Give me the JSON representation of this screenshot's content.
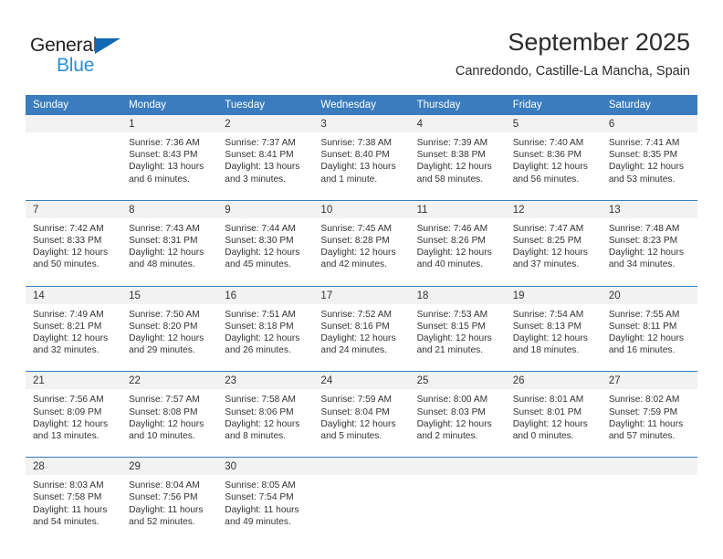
{
  "brand": {
    "name_part1": "General",
    "name_part2": "Blue",
    "color_dark": "#231f20",
    "color_blue": "#2b8fd4",
    "triangle_color": "#1268b3"
  },
  "header": {
    "title": "September 2025",
    "subtitle": "Canredondo, Castille-La Mancha, Spain",
    "accent_color": "#3a7cbe",
    "band_color": "#f2f2f2"
  },
  "calendar": {
    "weekday_headers": [
      "Sunday",
      "Monday",
      "Tuesday",
      "Wednesday",
      "Thursday",
      "Friday",
      "Saturday"
    ],
    "weeks": [
      {
        "days": [
          {
            "num": "",
            "l1": "",
            "l2": "",
            "l3": "",
            "l4": ""
          },
          {
            "num": "1",
            "l1": "Sunrise: 7:36 AM",
            "l2": "Sunset: 8:43 PM",
            "l3": "Daylight: 13 hours",
            "l4": "and 6 minutes."
          },
          {
            "num": "2",
            "l1": "Sunrise: 7:37 AM",
            "l2": "Sunset: 8:41 PM",
            "l3": "Daylight: 13 hours",
            "l4": "and 3 minutes."
          },
          {
            "num": "3",
            "l1": "Sunrise: 7:38 AM",
            "l2": "Sunset: 8:40 PM",
            "l3": "Daylight: 13 hours",
            "l4": "and 1 minute."
          },
          {
            "num": "4",
            "l1": "Sunrise: 7:39 AM",
            "l2": "Sunset: 8:38 PM",
            "l3": "Daylight: 12 hours",
            "l4": "and 58 minutes."
          },
          {
            "num": "5",
            "l1": "Sunrise: 7:40 AM",
            "l2": "Sunset: 8:36 PM",
            "l3": "Daylight: 12 hours",
            "l4": "and 56 minutes."
          },
          {
            "num": "6",
            "l1": "Sunrise: 7:41 AM",
            "l2": "Sunset: 8:35 PM",
            "l3": "Daylight: 12 hours",
            "l4": "and 53 minutes."
          }
        ]
      },
      {
        "days": [
          {
            "num": "7",
            "l1": "Sunrise: 7:42 AM",
            "l2": "Sunset: 8:33 PM",
            "l3": "Daylight: 12 hours",
            "l4": "and 50 minutes."
          },
          {
            "num": "8",
            "l1": "Sunrise: 7:43 AM",
            "l2": "Sunset: 8:31 PM",
            "l3": "Daylight: 12 hours",
            "l4": "and 48 minutes."
          },
          {
            "num": "9",
            "l1": "Sunrise: 7:44 AM",
            "l2": "Sunset: 8:30 PM",
            "l3": "Daylight: 12 hours",
            "l4": "and 45 minutes."
          },
          {
            "num": "10",
            "l1": "Sunrise: 7:45 AM",
            "l2": "Sunset: 8:28 PM",
            "l3": "Daylight: 12 hours",
            "l4": "and 42 minutes."
          },
          {
            "num": "11",
            "l1": "Sunrise: 7:46 AM",
            "l2": "Sunset: 8:26 PM",
            "l3": "Daylight: 12 hours",
            "l4": "and 40 minutes."
          },
          {
            "num": "12",
            "l1": "Sunrise: 7:47 AM",
            "l2": "Sunset: 8:25 PM",
            "l3": "Daylight: 12 hours",
            "l4": "and 37 minutes."
          },
          {
            "num": "13",
            "l1": "Sunrise: 7:48 AM",
            "l2": "Sunset: 8:23 PM",
            "l3": "Daylight: 12 hours",
            "l4": "and 34 minutes."
          }
        ]
      },
      {
        "days": [
          {
            "num": "14",
            "l1": "Sunrise: 7:49 AM",
            "l2": "Sunset: 8:21 PM",
            "l3": "Daylight: 12 hours",
            "l4": "and 32 minutes."
          },
          {
            "num": "15",
            "l1": "Sunrise: 7:50 AM",
            "l2": "Sunset: 8:20 PM",
            "l3": "Daylight: 12 hours",
            "l4": "and 29 minutes."
          },
          {
            "num": "16",
            "l1": "Sunrise: 7:51 AM",
            "l2": "Sunset: 8:18 PM",
            "l3": "Daylight: 12 hours",
            "l4": "and 26 minutes."
          },
          {
            "num": "17",
            "l1": "Sunrise: 7:52 AM",
            "l2": "Sunset: 8:16 PM",
            "l3": "Daylight: 12 hours",
            "l4": "and 24 minutes."
          },
          {
            "num": "18",
            "l1": "Sunrise: 7:53 AM",
            "l2": "Sunset: 8:15 PM",
            "l3": "Daylight: 12 hours",
            "l4": "and 21 minutes."
          },
          {
            "num": "19",
            "l1": "Sunrise: 7:54 AM",
            "l2": "Sunset: 8:13 PM",
            "l3": "Daylight: 12 hours",
            "l4": "and 18 minutes."
          },
          {
            "num": "20",
            "l1": "Sunrise: 7:55 AM",
            "l2": "Sunset: 8:11 PM",
            "l3": "Daylight: 12 hours",
            "l4": "and 16 minutes."
          }
        ]
      },
      {
        "days": [
          {
            "num": "21",
            "l1": "Sunrise: 7:56 AM",
            "l2": "Sunset: 8:09 PM",
            "l3": "Daylight: 12 hours",
            "l4": "and 13 minutes."
          },
          {
            "num": "22",
            "l1": "Sunrise: 7:57 AM",
            "l2": "Sunset: 8:08 PM",
            "l3": "Daylight: 12 hours",
            "l4": "and 10 minutes."
          },
          {
            "num": "23",
            "l1": "Sunrise: 7:58 AM",
            "l2": "Sunset: 8:06 PM",
            "l3": "Daylight: 12 hours",
            "l4": "and 8 minutes."
          },
          {
            "num": "24",
            "l1": "Sunrise: 7:59 AM",
            "l2": "Sunset: 8:04 PM",
            "l3": "Daylight: 12 hours",
            "l4": "and 5 minutes."
          },
          {
            "num": "25",
            "l1": "Sunrise: 8:00 AM",
            "l2": "Sunset: 8:03 PM",
            "l3": "Daylight: 12 hours",
            "l4": "and 2 minutes."
          },
          {
            "num": "26",
            "l1": "Sunrise: 8:01 AM",
            "l2": "Sunset: 8:01 PM",
            "l3": "Daylight: 12 hours",
            "l4": "and 0 minutes."
          },
          {
            "num": "27",
            "l1": "Sunrise: 8:02 AM",
            "l2": "Sunset: 7:59 PM",
            "l3": "Daylight: 11 hours",
            "l4": "and 57 minutes."
          }
        ]
      },
      {
        "days": [
          {
            "num": "28",
            "l1": "Sunrise: 8:03 AM",
            "l2": "Sunset: 7:58 PM",
            "l3": "Daylight: 11 hours",
            "l4": "and 54 minutes."
          },
          {
            "num": "29",
            "l1": "Sunrise: 8:04 AM",
            "l2": "Sunset: 7:56 PM",
            "l3": "Daylight: 11 hours",
            "l4": "and 52 minutes."
          },
          {
            "num": "30",
            "l1": "Sunrise: 8:05 AM",
            "l2": "Sunset: 7:54 PM",
            "l3": "Daylight: 11 hours",
            "l4": "and 49 minutes."
          },
          {
            "num": "",
            "l1": "",
            "l2": "",
            "l3": "",
            "l4": ""
          },
          {
            "num": "",
            "l1": "",
            "l2": "",
            "l3": "",
            "l4": ""
          },
          {
            "num": "",
            "l1": "",
            "l2": "",
            "l3": "",
            "l4": ""
          },
          {
            "num": "",
            "l1": "",
            "l2": "",
            "l3": "",
            "l4": ""
          }
        ]
      }
    ]
  }
}
